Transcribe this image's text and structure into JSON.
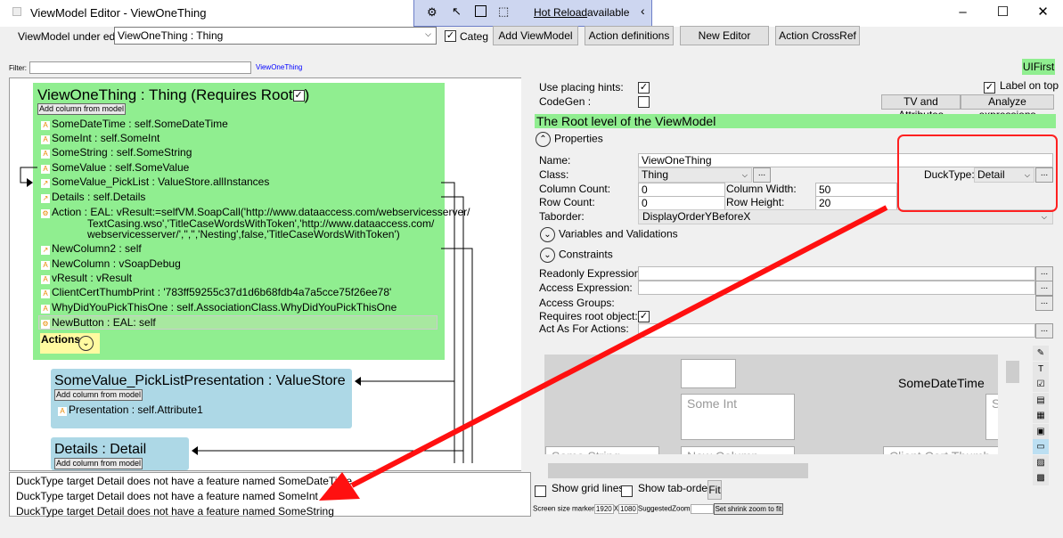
{
  "window": {
    "title": "ViewModel Editor - ViewOneThing",
    "minimize": "–",
    "maximize": "☐",
    "close": "✕"
  },
  "hotreload": {
    "label": "Hot Reload",
    "suffix": " available",
    "collapse": "‹"
  },
  "toolbar": {
    "vm_label": "ViewModel under edit:",
    "vm_value": "ViewOneThing : Thing",
    "categ": "Categ",
    "categ_checked": true,
    "add_vm": "Add ViewModel",
    "action_defs": "Action definitions",
    "new_editor": "New Editor",
    "action_xref": "Action CrossRef"
  },
  "filter": {
    "label": "Filter:",
    "value": "",
    "link": "ViewOneThing"
  },
  "root_box": {
    "title": "ViewOneThing : Thing  (Requires Root",
    "requires_root": true,
    "close_paren": ")",
    "add_col": "Add column from model",
    "columns": [
      "SomeDateTime : self.SomeDateTime",
      "SomeInt : self.SomeInt",
      "SomeString : self.SomeString",
      "SomeValue : self.SomeValue",
      "SomeValue_PickList : ValueStore.allInstances",
      "Details : self.Details"
    ],
    "action": [
      "Action : EAL: vResult:=selfVM.SoapCall('http://www.dataaccess.com/webservicesserver/",
      "TextCasing.wso','TitleCaseWordsWithToken','http://www.dataaccess.com/",
      "webservicesserver/','','','Nesting',false,'TitleCaseWordsWithToken')"
    ],
    "columns2": [
      "NewColumn2 : self",
      "NewColumn : vSoapDebug",
      "vResult : vResult",
      "ClientCertThumbPrint : '783ff59255c37d1d6b68fdb4a7a5cce75f26ee78'",
      "WhyDidYouPickThisOne : self.AssociationClass.WhyDidYouPickThisOne",
      "NewButton : EAL: self"
    ],
    "actions_label": "Actions"
  },
  "picklist_box": {
    "title": "SomeValue_PickListPresentation : ValueStore",
    "add_col": "Add column from model",
    "columns": [
      "Presentation : self.Attribute1"
    ]
  },
  "details_box": {
    "title": "Details : Detail",
    "add_col": "Add column from model"
  },
  "messages": [
    "DuckType target Detail does not have a feature named SomeDateTime",
    "DuckType target Detail does not have a feature named SomeInt",
    "DuckType target Detail does not have a feature named SomeString"
  ],
  "right": {
    "uifirst": "UIFirst",
    "use_placing_hints": "Use placing hints:",
    "use_placing_hints_checked": true,
    "codegen": "CodeGen :",
    "codegen_checked": false,
    "label_on_top": "Label on top",
    "label_on_top_checked": true,
    "tv_attr": "TV and Attributes",
    "analyze": "Analyze expressions",
    "header": "The Root level of the ViewModel",
    "properties": "Properties",
    "name_label": "Name:",
    "name_value": "ViewOneThing",
    "class_label": "Class:",
    "class_value": "Thing",
    "ducktype_label": "DuckType:",
    "ducktype_value": "Detail",
    "colcount_label": "Column Count:",
    "colcount": "0",
    "colwidth_label": "Column Width:",
    "colwidth": "50",
    "rowcount_label": "Row Count:",
    "rowcount": "0",
    "rowheight_label": "Row Height:",
    "rowheight": "20",
    "taborder_label": "Taborder:",
    "taborder_value": "DisplayOrderYBeforeX",
    "variables": "Variables and Validations",
    "constraints": "Constraints",
    "readonly": "Readonly Expression:",
    "access": "Access Expression:",
    "access_groups": "Access Groups:",
    "requires_root": "Requires root object:",
    "requires_root_checked": true,
    "act_as": "Act As For Actions:",
    "ellipsis": "..."
  },
  "designer": {
    "somedatetime": "SomeDateTime",
    "someint": "Some Int",
    "somestring": "Some String",
    "newcolumn": "New Column",
    "clientcert": "Client Cert Thumb",
    "s": "S"
  },
  "bottom": {
    "grid": "Show grid lines",
    "taborder": "Show tab-order",
    "fit": "Fit",
    "screen_marker": "Screen size marker",
    "w": "1920",
    "x": "X",
    "h": "1080",
    "suggested": "SuggestedZoom",
    "zoom": "",
    "shrink": "Set shrink zoom to fit"
  },
  "colors": {
    "root_box": "#90ee90",
    "sub_box": "#add8e6",
    "annotation": "#ff0000",
    "actions_bg": "#fffaa0"
  }
}
